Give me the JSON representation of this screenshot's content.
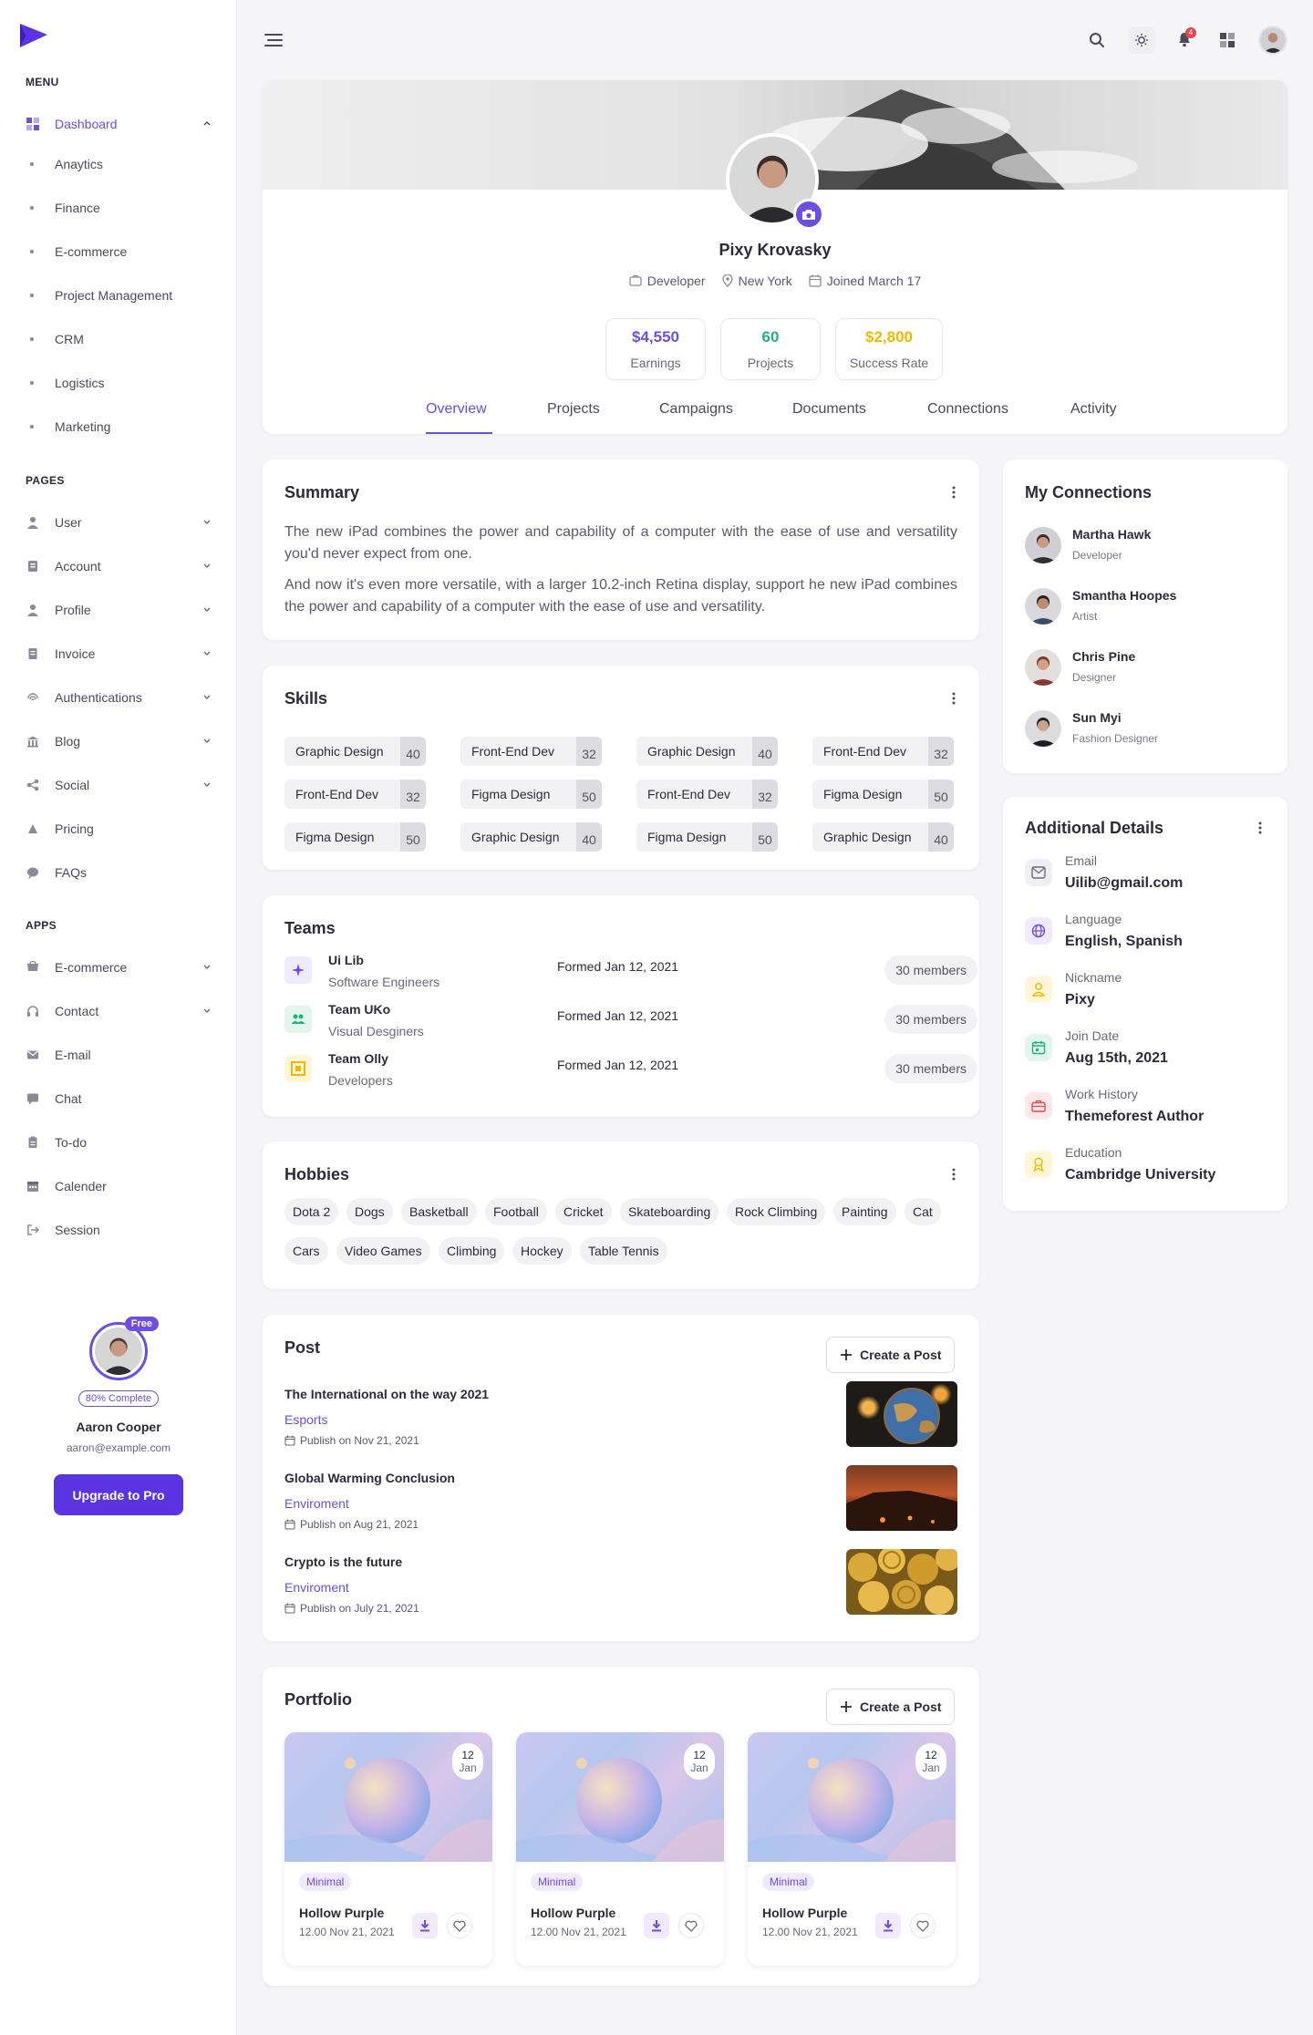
{
  "sidebar": {
    "menu_title": "MENU",
    "dashboard": "Dashboard",
    "dashboard_items": [
      "Anaytics",
      "Finance",
      "E-commerce",
      "Project Management",
      "CRM",
      "Logistics",
      "Marketing"
    ],
    "pages_title": "PAGES",
    "pages": [
      "User",
      "Account",
      "Profile",
      "Invoice",
      "Authentications",
      "Blog",
      "Social",
      "Pricing",
      "FAQs"
    ],
    "apps_title": "APPS",
    "apps": [
      "E-commerce",
      "Contact",
      "E-mail",
      "Chat",
      "To-do",
      "Calender",
      "Session"
    ],
    "user": {
      "badge": "Free",
      "progress_label": "80% Complete",
      "progress": 0.8,
      "name": "Aaron Cooper",
      "email": "aaron@example.com",
      "button": "Upgrade to Pro"
    }
  },
  "topbar": {
    "notification_count": "4"
  },
  "profile": {
    "name": "Pixy Krovasky",
    "role": "Developer",
    "location": "New York",
    "joined": "Joined March 17",
    "stats": [
      {
        "value": "$4,550",
        "label": "Earnings",
        "color": "#6c4ee3"
      },
      {
        "value": "60",
        "label": "Projects",
        "color": "#22b07d"
      },
      {
        "value": "$2,800",
        "label": "Success Rate",
        "color": "#f5b800"
      }
    ],
    "tabs": [
      "Overview",
      "Projects",
      "Campaigns",
      "Documents",
      "Connections",
      "Activity"
    ]
  },
  "summary": {
    "title": "Summary",
    "p1": "The new iPad combines the power and capability of a computer with the ease of use and versatility you'd never expect from one.",
    "p2": "And now it's even more versatile, with a larger 10.2-inch Retina display, support he new iPad combines the power and capability of a computer with the ease of use and versatility."
  },
  "skills": {
    "title": "Skills",
    "items": [
      {
        "name": "Graphic Design",
        "value": "40"
      },
      {
        "name": "Front-End Dev",
        "value": "32"
      },
      {
        "name": "Graphic Design",
        "value": "40"
      },
      {
        "name": "Front-End Dev",
        "value": "32"
      },
      {
        "name": "Front-End Dev",
        "value": "32"
      },
      {
        "name": "Figma Design",
        "value": "50"
      },
      {
        "name": "Front-End Dev",
        "value": "32"
      },
      {
        "name": "Figma Design",
        "value": "50"
      },
      {
        "name": "Figma Design",
        "value": "50"
      },
      {
        "name": "Graphic Design",
        "value": "40"
      },
      {
        "name": "Figma Design",
        "value": "50"
      },
      {
        "name": "Graphic Design",
        "value": "40"
      }
    ]
  },
  "teams": {
    "title": "Teams",
    "items": [
      {
        "name": "Ui Lib",
        "sub": "Software Engineers",
        "formed": "Formed Jan 12, 2021",
        "members": "30 members"
      },
      {
        "name": "Team UKo",
        "sub": "Visual Desginers",
        "formed": "Formed Jan 12, 2021",
        "members": "30 members"
      },
      {
        "name": "Team Olly",
        "sub": "Developers",
        "formed": "Formed Jan 12, 2021",
        "members": "30 members"
      }
    ]
  },
  "hobbies": {
    "title": "Hobbies",
    "items": [
      "Dota 2",
      "Dogs",
      "Basketball",
      "Football",
      "Cricket",
      "Skateboarding",
      "Rock Climbing",
      "Painting",
      "Cat",
      "Cars",
      "Video Games",
      "Climbing",
      "Hockey",
      "Table Tennis"
    ]
  },
  "posts": {
    "title": "Post",
    "button": "Create a Post",
    "items": [
      {
        "title": "The International on the way 2021",
        "category": "Esports",
        "date": "Publish on Nov 21, 2021"
      },
      {
        "title": "Global Warming Conclusion",
        "category": "Enviroment",
        "date": "Publish on Aug 21, 2021"
      },
      {
        "title": "Crypto is the future",
        "category": "Enviroment",
        "date": "Publish on July 21, 2021"
      }
    ]
  },
  "portfolio": {
    "title": "Portfolio",
    "button": "Create a Post",
    "items": [
      {
        "day": "12",
        "month": "Jan",
        "tag": "Minimal",
        "title": "Hollow Purple",
        "date": "12.00 Nov 21, 2021"
      },
      {
        "day": "12",
        "month": "Jan",
        "tag": "Minimal",
        "title": "Hollow Purple",
        "date": "12.00 Nov 21, 2021"
      },
      {
        "day": "12",
        "month": "Jan",
        "tag": "Minimal",
        "title": "Hollow Purple",
        "date": "12.00 Nov 21, 2021"
      }
    ]
  },
  "connections": {
    "title": "My Connections",
    "items": [
      {
        "name": "Martha Hawk",
        "role": "Developer"
      },
      {
        "name": "Smantha Hoopes",
        "role": "Artist"
      },
      {
        "name": "Chris Pine",
        "role": "Designer"
      },
      {
        "name": "Sun Myi",
        "role": "Fashion Designer"
      }
    ]
  },
  "details": {
    "title": "Additional Details",
    "items": [
      {
        "key": "Email",
        "value": "Uilib@gmail.com",
        "icon": "mail-icon",
        "color": "#6a6a7a"
      },
      {
        "key": "Language",
        "value": "English, Spanish",
        "icon": "globe-icon",
        "color": "#6c4ee3"
      },
      {
        "key": "Nickname",
        "value": "Pixy",
        "icon": "user-icon",
        "color": "#f5b800"
      },
      {
        "key": "Join Date",
        "value": "Aug 15th, 2021",
        "icon": "calendar-icon",
        "color": "#22b07d"
      },
      {
        "key": "Work History",
        "value": "Themeforest Author",
        "icon": "briefcase-icon",
        "color": "#e5484d"
      },
      {
        "key": "Education",
        "value": "Cambridge University",
        "icon": "graduation-icon",
        "color": "#f5b800"
      }
    ]
  },
  "colors": {
    "accent": "#6c4ee3",
    "success": "#22b07d",
    "warning": "#f5b800",
    "danger": "#e5484d"
  }
}
